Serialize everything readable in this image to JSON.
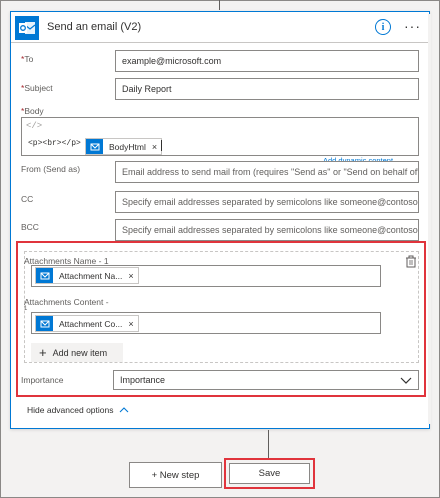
{
  "header": {
    "title": "Send an email (V2)"
  },
  "fields": {
    "to": {
      "label": "To",
      "value": "example@microsoft.com"
    },
    "subject": {
      "label": "Subject",
      "value": "Daily Report"
    },
    "body": {
      "label": "Body",
      "code_glyph": "</>",
      "html_text": "<p><br></p>",
      "token_label": "BodyHtml",
      "add_dynamic": "Add dynamic content"
    },
    "from": {
      "label": "From (Send as)",
      "placeholder": "Email address to send mail from (requires \"Send as\" or \"Send on behalf of\" permission)"
    },
    "cc": {
      "label": "CC",
      "placeholder": "Specify email addresses separated by semicolons like someone@contoso.com"
    },
    "bcc": {
      "label": "BCC",
      "placeholder": "Specify email addresses separated by semicolons like someone@contoso.com"
    }
  },
  "attachments": {
    "name_label": "Attachments Name - 1",
    "name_token": "Attachment Na...",
    "content_label": "Attachments Content -",
    "content_sub": "1",
    "content_token": "Attachment Co...",
    "add_new_item": "Add new item"
  },
  "importance": {
    "label": "Importance",
    "value": "Importance"
  },
  "hide_advanced": "Hide advanced options",
  "footer": {
    "new_step": "+ New step",
    "save": "Save"
  },
  "colors": {
    "accent": "#0078d4",
    "highlight": "#e0343c"
  }
}
